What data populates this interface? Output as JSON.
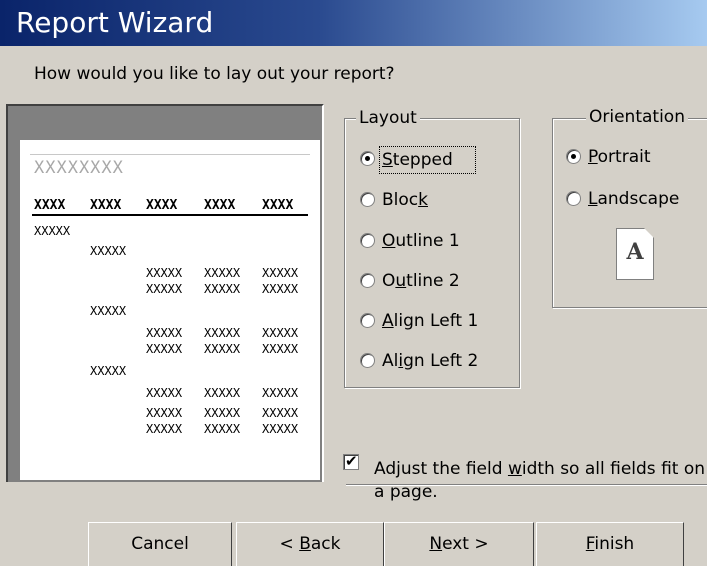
{
  "window": {
    "title": "Report Wizard"
  },
  "prompt": "How would you like to lay out your report?",
  "preview": {
    "title_placeholder": "XXXXXXXX",
    "header_cells": [
      "XXXX",
      "XXXX",
      "XXXX",
      "XXXX",
      "XXXX"
    ],
    "cell_text": "XXXXX"
  },
  "layout_group": {
    "label": "Layout",
    "options": [
      {
        "pre": "",
        "key": "S",
        "post": "tepped",
        "selected": true
      },
      {
        "pre": "Bloc",
        "key": "k",
        "post": "",
        "selected": false
      },
      {
        "pre": "",
        "key": "O",
        "post": "utline 1",
        "selected": false
      },
      {
        "pre": "O",
        "key": "u",
        "post": "tline 2",
        "selected": false
      },
      {
        "pre": "",
        "key": "A",
        "post": "lign Left 1",
        "selected": false
      },
      {
        "pre": "Al",
        "key": "i",
        "post": "gn Left 2",
        "selected": false
      }
    ]
  },
  "orientation_group": {
    "label": "Orientation",
    "options": [
      {
        "pre": "",
        "key": "P",
        "post": "ortrait",
        "selected": true
      },
      {
        "pre": "",
        "key": "L",
        "post": "andscape",
        "selected": false
      }
    ],
    "page_icon_letter": "A"
  },
  "adjust_checkbox": {
    "checked": true,
    "line1_pre": "Adjust the field ",
    "line1_key": "w",
    "line1_post": "idth so all fields fit on",
    "line2": "a page."
  },
  "buttons": {
    "cancel": "Cancel",
    "back_pre": "< ",
    "back_key": "B",
    "back_post": "ack",
    "next_key": "N",
    "next_post": "ext >",
    "finish_key": "F",
    "finish_post": "inish"
  },
  "colors": {
    "dialog_bg": "#D4D0C8",
    "title_start": "#0A246A",
    "title_end": "#A6CAF0"
  }
}
